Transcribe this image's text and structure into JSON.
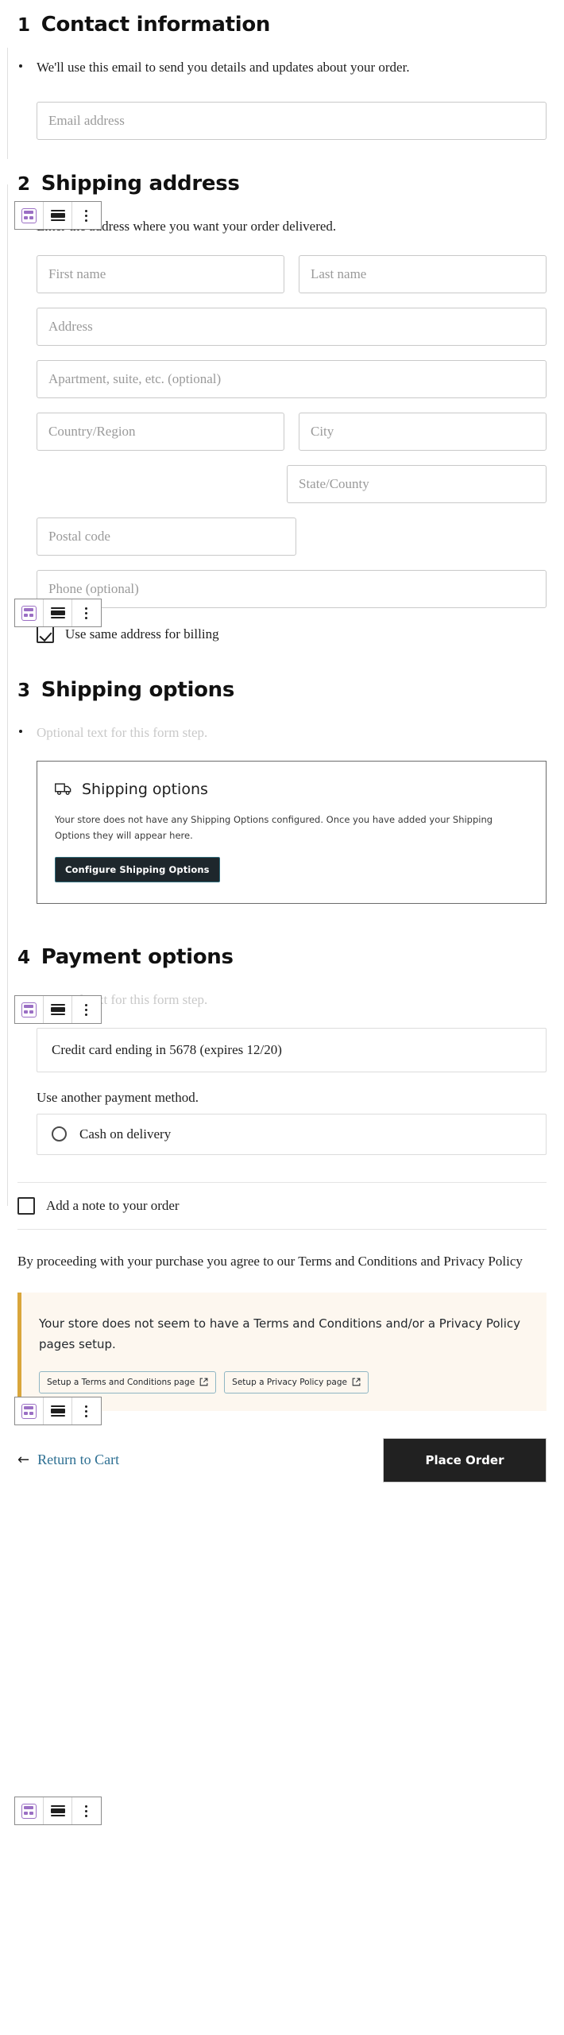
{
  "steps": [
    {
      "number": "1",
      "title": "Contact information",
      "description": "We'll use this email to send you details and updates about your order.",
      "fields": [
        {
          "placeholder": "Email address"
        }
      ]
    },
    {
      "number": "2",
      "title": "Shipping address",
      "description": "Enter the address where you want your order delivered.",
      "fields": [
        {
          "placeholder": "First name"
        },
        {
          "placeholder": "Last name"
        },
        {
          "placeholder": "Address"
        },
        {
          "placeholder": "Apartment, suite, etc. (optional)"
        },
        {
          "placeholder": "Country/Region"
        },
        {
          "placeholder": "City"
        },
        {
          "placeholder": "State/County"
        },
        {
          "placeholder": "Postal code"
        },
        {
          "placeholder": "Phone (optional)"
        }
      ],
      "billing_checkbox": {
        "label": "Use same address for billing",
        "checked": true
      }
    },
    {
      "number": "3",
      "title": "Shipping options",
      "description": "Optional text for this form step.",
      "panel": {
        "icon": "truck-icon",
        "heading": "Shipping options",
        "body": "Your store does not have any Shipping Options configured. Once you have added your Shipping Options they will appear here.",
        "button": "Configure Shipping Options"
      }
    },
    {
      "number": "4",
      "title": "Payment options",
      "description": "Optional text for this form step.",
      "saved_card": "Credit card ending in 5678 (expires 12/20)",
      "another_method_label": "Use another payment method.",
      "methods": [
        {
          "label": "Cash on delivery",
          "selected": false
        }
      ]
    }
  ],
  "order_note": {
    "label": "Add a note to your order",
    "checked": false
  },
  "terms_text": "By proceeding with your purchase you agree to our Terms and Conditions and Privacy Policy",
  "notice": {
    "text": "Your store does not seem to have a Terms and Conditions and/or a Privacy Policy pages setup.",
    "buttons": [
      {
        "label": "Setup a Terms and Conditions page",
        "icon": "external-link-icon"
      },
      {
        "label": "Setup a Privacy Policy page",
        "icon": "external-link-icon"
      }
    ],
    "accent_color": "#d9a63b",
    "background_color": "#fdf7ef"
  },
  "footer": {
    "return_label": "Return to Cart",
    "return_icon": "arrow-left-icon",
    "place_order_label": "Place Order",
    "place_order_color": "#212121",
    "return_color": "#2d6f92"
  },
  "block_toolbar": {
    "buttons": [
      {
        "icon": "form-block-icon",
        "name": "block-type-button"
      },
      {
        "icon": "align-icon",
        "name": "align-button"
      },
      {
        "icon": "vertical-dots-icon",
        "name": "more-options-button"
      }
    ],
    "accent_color": "#9b6fc4"
  }
}
